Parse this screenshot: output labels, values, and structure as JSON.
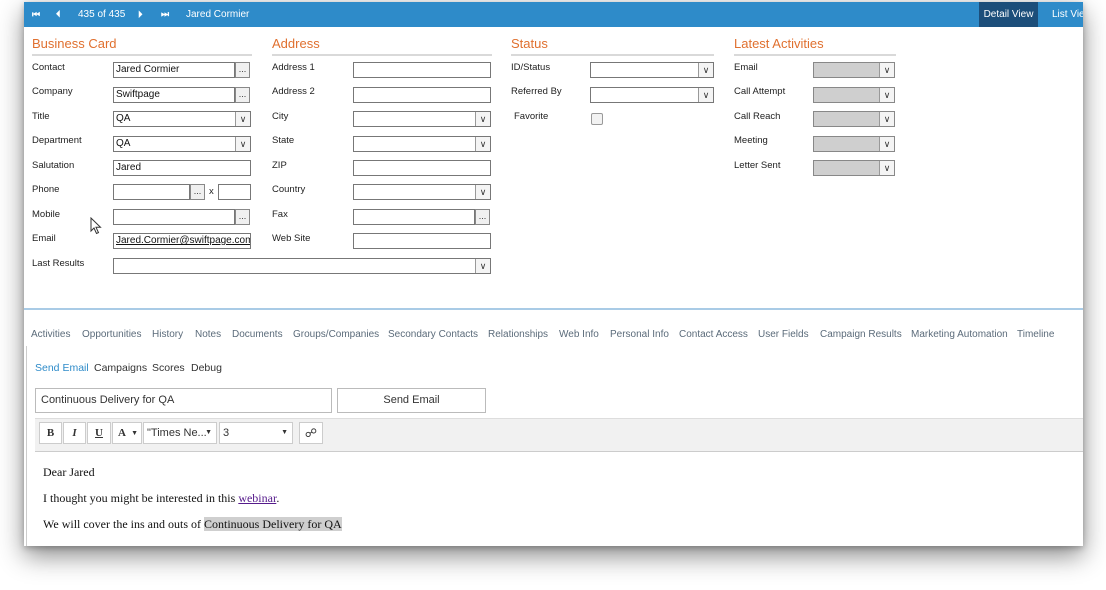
{
  "topbar": {
    "nav_first": "⏮",
    "nav_prev": "⏴",
    "pager_text": "435 of 435",
    "nav_next": "⏵",
    "nav_last": "⏭",
    "record_name": "Jared Cormier",
    "views": [
      "Detail View",
      "List View"
    ]
  },
  "business_card": {
    "title": "Business Card",
    "contact_label": "Contact",
    "contact_value": "Jared Cormier",
    "company_label": "Company",
    "company_value": "Swiftpage",
    "title_label": "Title",
    "title_value": "QA",
    "department_label": "Department",
    "department_value": "QA",
    "salutation_label": "Salutation",
    "salutation_value": "Jared",
    "phone_label": "Phone",
    "phone_value": "",
    "phone_ext_sep": "x",
    "phone_ext_value": "",
    "mobile_label": "Mobile",
    "mobile_value": "",
    "email_label": "Email",
    "email_value": "Jared.Cormier@swiftpage.com",
    "last_results_label": "Last Results",
    "last_results_value": ""
  },
  "address": {
    "title": "Address",
    "address1_label": "Address 1",
    "address2_label": "Address 2",
    "city_label": "City",
    "state_label": "State",
    "zip_label": "ZIP",
    "country_label": "Country",
    "fax_label": "Fax",
    "website_label": "Web Site"
  },
  "status": {
    "title": "Status",
    "id_status_label": "ID/Status",
    "referred_by_label": "Referred By",
    "favorite_label": "Favorite"
  },
  "latest_activities": {
    "title": "Latest Activities",
    "email_label": "Email",
    "call_attempt_label": "Call Attempt",
    "call_reach_label": "Call Reach",
    "meeting_label": "Meeting",
    "letter_sent_label": "Letter Sent"
  },
  "tabs": [
    "Activities",
    "Opportunities",
    "History",
    "Notes",
    "Documents",
    "Groups/Companies",
    "Secondary Contacts",
    "Relationships",
    "Web Info",
    "Personal Info",
    "Contact Access",
    "User Fields",
    "Campaign Results",
    "Marketing Automation",
    "Timeline"
  ],
  "subtabs": [
    "Send Email",
    "Campaigns",
    "Scores",
    "Debug"
  ],
  "email_compose": {
    "subject": "Continuous Delivery for QA",
    "send_label": "Send Email",
    "bold": "B",
    "italic": "I",
    "underline": "U",
    "font_color": "A",
    "font_name": "\"Times Ne...",
    "font_size": "3",
    "line1": "Dear Jared",
    "line2_pre": "I thought you might be interested in this ",
    "line2_link": "webinar",
    "line2_post": ".",
    "line3_pre": "We will cover the ins and outs of ",
    "line3_highlight": "Continuous Delivery for QA"
  },
  "colors": {
    "topbar": "#2e8bc9",
    "section_title": "#e0702f",
    "active_subtab": "#2e8bc9"
  }
}
